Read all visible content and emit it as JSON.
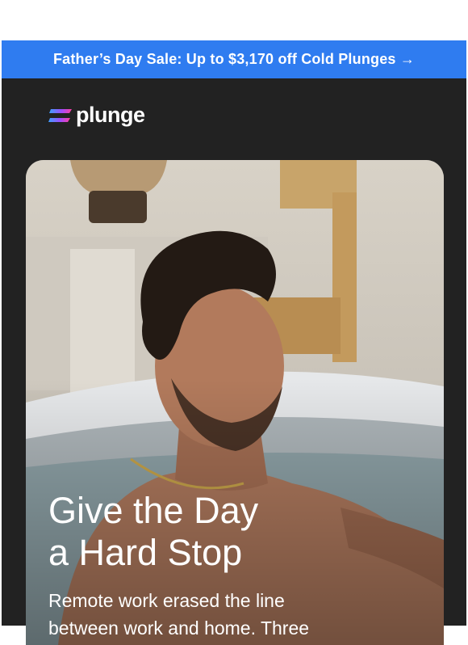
{
  "banner": {
    "text": "Father’s Day Sale: Up to $3,170 off Cold Plunges →"
  },
  "logo": {
    "wordmark": "plunge",
    "icon": "plunge-logo-icon"
  },
  "hero": {
    "headline_line1": "Give the Day",
    "headline_line2": "a Hard Stop",
    "body_line1": "Remote work erased the line",
    "body_line2": "between work and home. Three"
  },
  "colors": {
    "banner": "#2f7cf0",
    "background": "#222222",
    "text": "#ffffff"
  }
}
